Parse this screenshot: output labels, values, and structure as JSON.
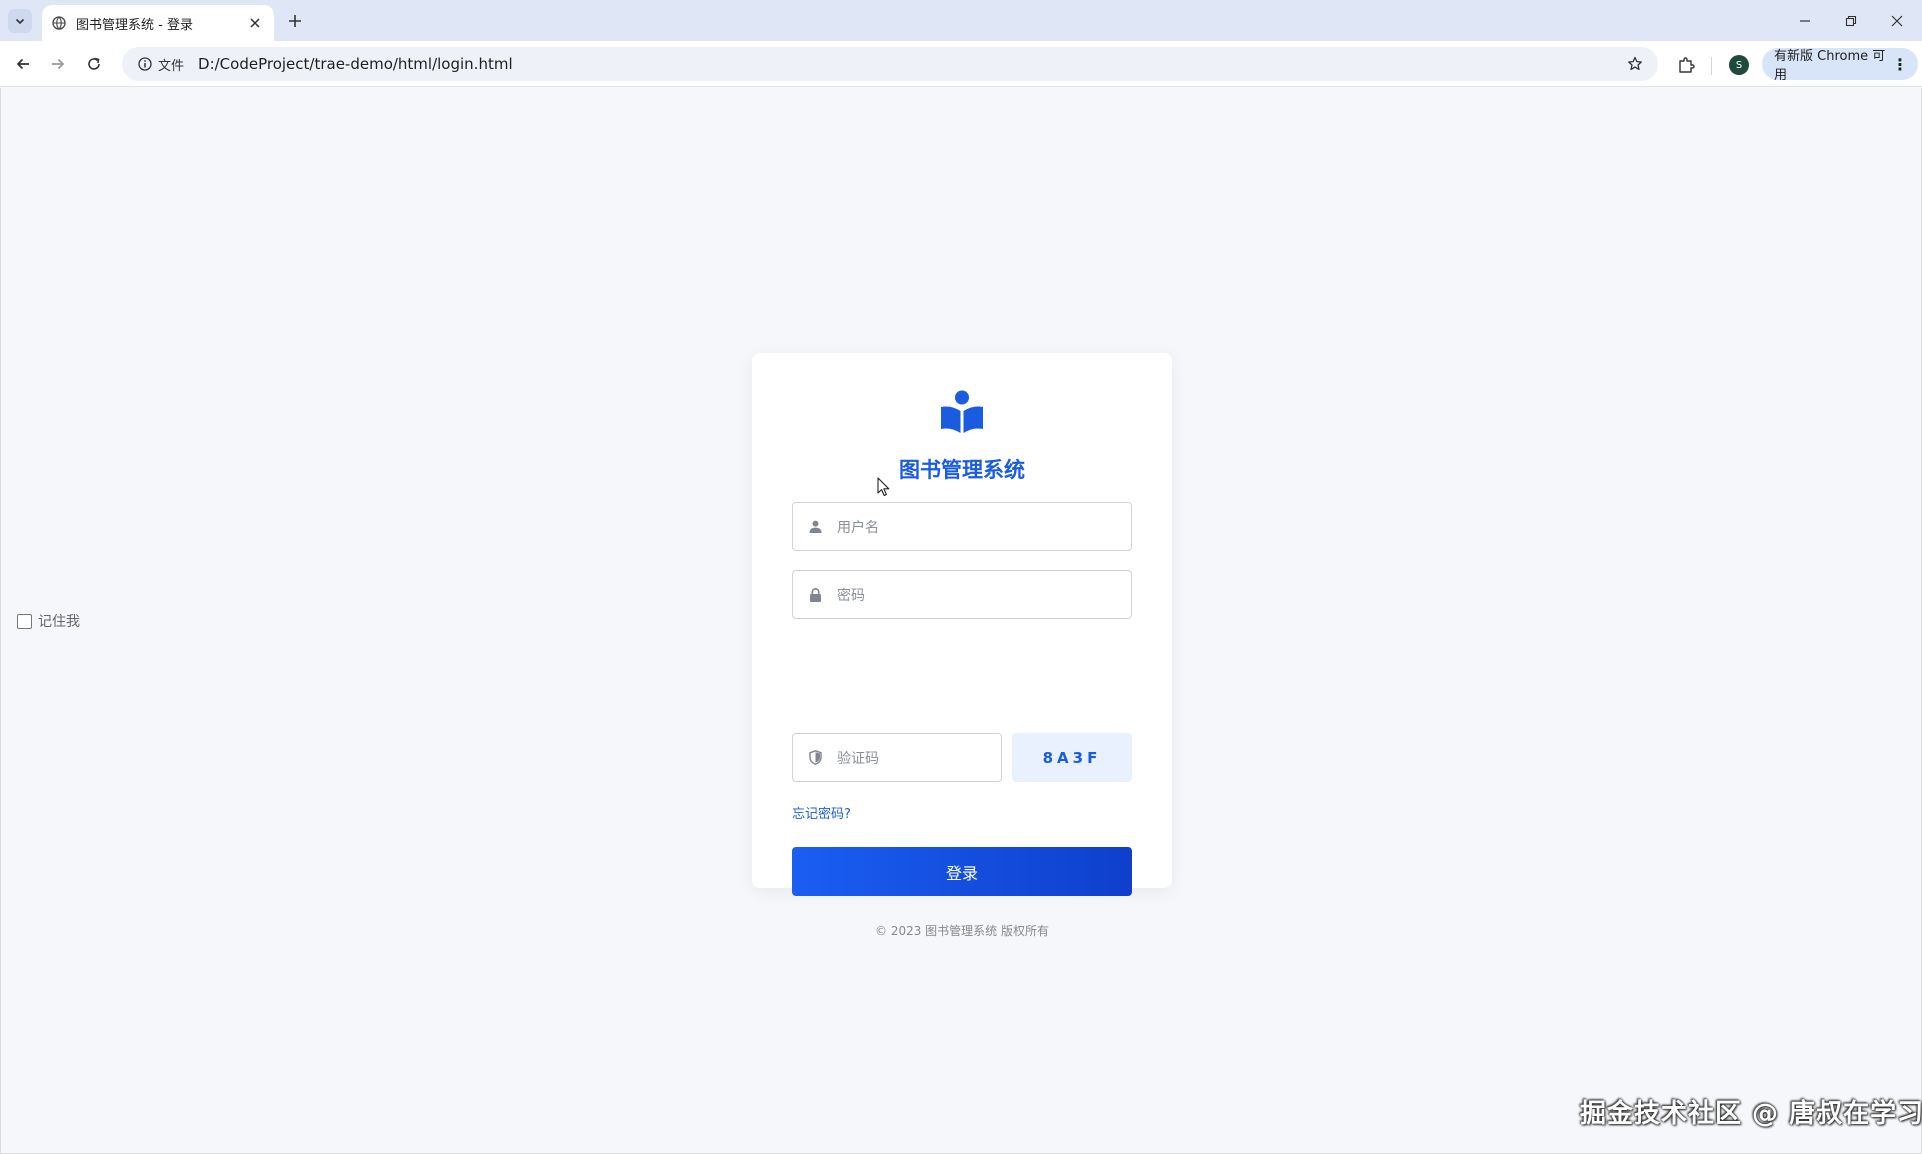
{
  "browser": {
    "tab_title": "图书管理系统 - 登录",
    "site_chip_label": "文件",
    "url": "D:/CodeProject/trae-demo/html/login.html",
    "avatar_letter": "S",
    "update_label": "有新版 Chrome 可用"
  },
  "page": {
    "remember_label": "记住我",
    "system_title": "图书管理系统",
    "username_placeholder": "用户名",
    "password_placeholder": "密码",
    "captcha_placeholder": "验证码",
    "captcha_code": "8A3F",
    "forgot_label": "忘记密码?",
    "login_label": "登录",
    "copyright": "© 2023 图书管理系统 版权所有"
  },
  "watermark": "掘金技术社区 @ 唐叔在学习",
  "colors": {
    "accent": "#1a5ce0",
    "page_bg": "#f5f7fa",
    "captcha_bg": "#e8f1fd"
  }
}
